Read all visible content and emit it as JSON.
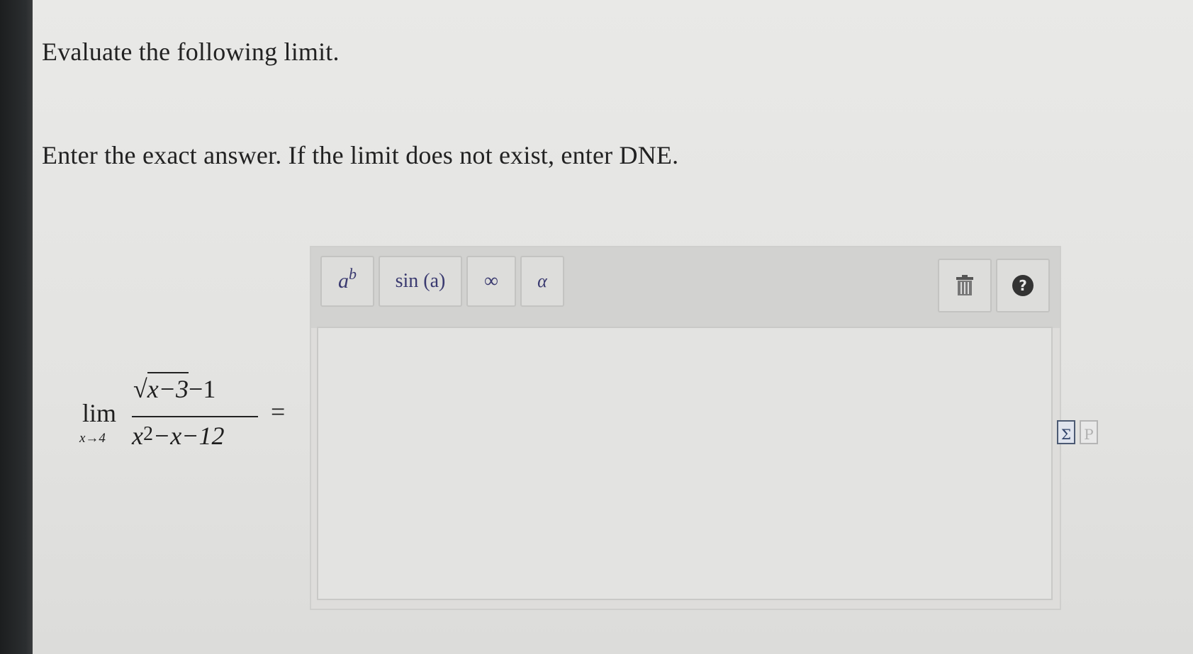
{
  "question": {
    "prompt": "Evaluate the following limit.",
    "instructions": "Enter the exact answer. If the limit does not exist, enter DNE."
  },
  "expression": {
    "lim": "lim",
    "sub": "x→4",
    "numerator_radicand": "x−3",
    "numerator_tail": "−1",
    "denominator_base": "x",
    "denominator_exp": "2",
    "denominator_tail": "−x−12",
    "equals": "="
  },
  "toolbar": {
    "power_base": "a",
    "power_exp": "b",
    "sin_label": "sin (a)",
    "infinity_label": "∞",
    "alpha_label": "α",
    "help_label": "?"
  },
  "answer": {
    "value": ""
  },
  "side_icons": {
    "equation_label": "Σ",
    "preview_label": "P"
  },
  "colors": {
    "bezel": "#2b2e30",
    "button_text": "#3a3a70",
    "background": "#e4e4e2"
  }
}
